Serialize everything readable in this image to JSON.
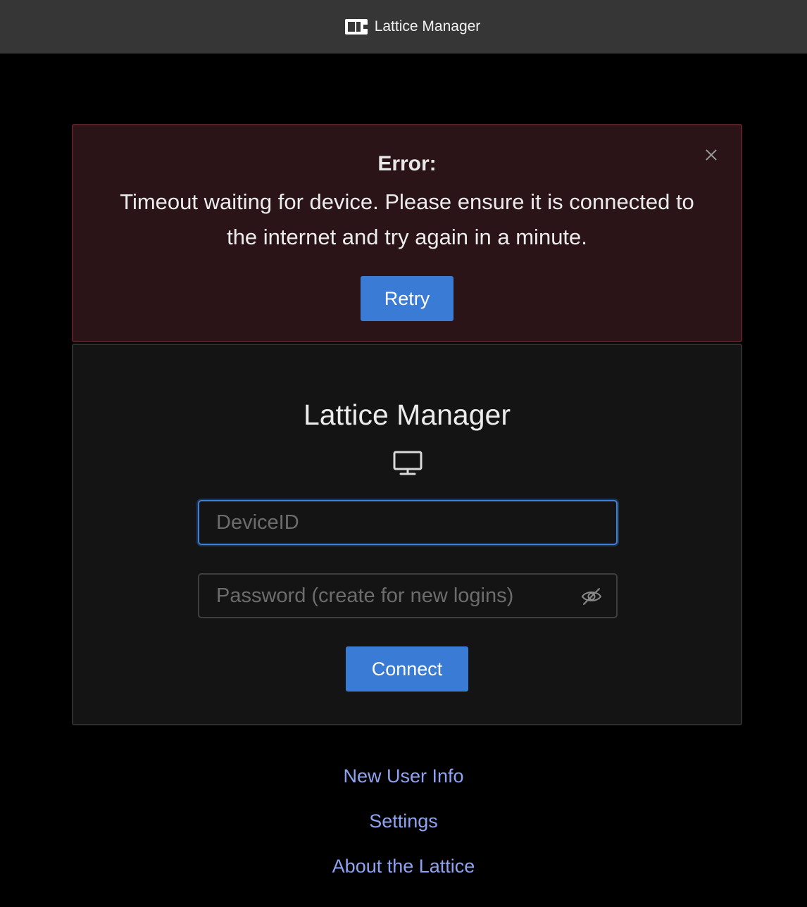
{
  "window": {
    "title": "Lattice Manager",
    "icon": "lattice-app-icon"
  },
  "error": {
    "heading": "Error:",
    "message": "Timeout waiting for device. Please ensure it is connected to the internet and try again in a minute.",
    "retry_label": "Retry",
    "close_icon": "close-icon"
  },
  "login": {
    "title": "Lattice Manager",
    "device_icon": "monitor-icon",
    "device_id": {
      "value": "",
      "placeholder": "DeviceID"
    },
    "password": {
      "value": "",
      "placeholder": "Password (create for new logins)",
      "toggle_icon": "eye-slash-icon"
    },
    "connect_label": "Connect"
  },
  "links": {
    "new_user_info": "New User Info",
    "settings": "Settings",
    "about": "About the Lattice"
  },
  "colors": {
    "accent": "#3a7bd5",
    "error_bg": "#2a1417",
    "link": "#8ea3f2"
  }
}
